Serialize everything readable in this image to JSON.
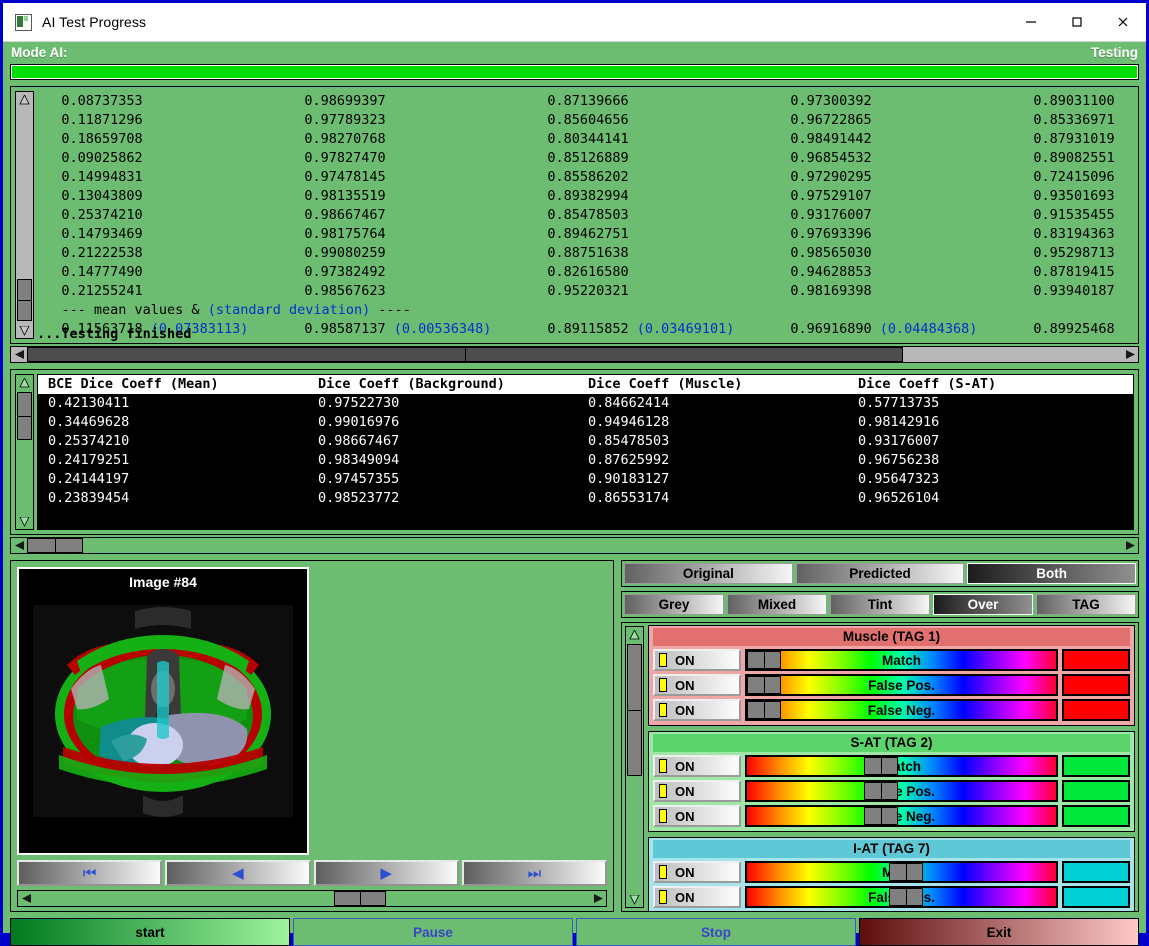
{
  "window": {
    "title": "AI Test Progress",
    "icon": "app-icon",
    "minimize": "—",
    "maximize": "□",
    "close": "✕"
  },
  "mode_bar": {
    "label": "Mode AI:",
    "status": "Testing"
  },
  "progress": {
    "percent": 100,
    "color": "#00e000"
  },
  "log": {
    "rows": [
      [
        "0.08737353",
        "0.98699397",
        "0.87139666",
        "0.97300392",
        "0.89031100"
      ],
      [
        "0.11871296",
        "0.97789323",
        "0.85604656",
        "0.96722865",
        "0.85336971"
      ],
      [
        "0.18659708",
        "0.98270768",
        "0.80344141",
        "0.98491442",
        "0.87931019"
      ],
      [
        "0.09025862",
        "0.97827470",
        "0.85126889",
        "0.96854532",
        "0.89082551"
      ],
      [
        "0.14994831",
        "0.97478145",
        "0.85586202",
        "0.97290295",
        "0.72415096"
      ],
      [
        "0.13043809",
        "0.98135519",
        "0.89382994",
        "0.97529107",
        "0.93501693"
      ],
      [
        "0.25374210",
        "0.98667467",
        "0.85478503",
        "0.93176007",
        "0.91535455"
      ],
      [
        "0.14793469",
        "0.98175764",
        "0.89462751",
        "0.97693396",
        "0.83194363"
      ],
      [
        "0.21222538",
        "0.99080259",
        "0.88751638",
        "0.98565030",
        "0.95298713"
      ],
      [
        "0.14777490",
        "0.97382492",
        "0.82616580",
        "0.94628853",
        "0.87819415"
      ],
      [
        "0.21255241",
        "0.98567623",
        "0.95220321",
        "0.98169398",
        "0.93940187"
      ]
    ],
    "separator_prefix": "--- mean values & ",
    "separator_blue": "(standard deviation)",
    "separator_suffix": " ----",
    "means": [
      {
        "mean": "0.11563718",
        "sd": "(0.07383113)"
      },
      {
        "mean": "0.98587137",
        "sd": "(0.00536348)"
      },
      {
        "mean": "0.89115852",
        "sd": "(0.03469101)"
      },
      {
        "mean": "0.96916890",
        "sd": "(0.04484368)"
      },
      {
        "mean": "0.89925468",
        "sd": ""
      }
    ],
    "footer": "...Testing finished"
  },
  "table": {
    "headers": [
      "BCE Dice Coeff (Mean)",
      "Dice Coeff (Background)",
      "Dice Coeff (Muscle)",
      "Dice Coeff (S-AT)"
    ],
    "rows": [
      [
        "0.42130411",
        "0.97522730",
        "0.84662414",
        "0.57713735"
      ],
      [
        "0.34469628",
        "0.99016976",
        "0.94946128",
        "0.98142916"
      ],
      [
        "0.25374210",
        "0.98667467",
        "0.85478503",
        "0.93176007"
      ],
      [
        "0.24179251",
        "0.98349094",
        "0.87625992",
        "0.96756238"
      ],
      [
        "0.24144197",
        "0.97457355",
        "0.90183127",
        "0.95647323"
      ],
      [
        "0.23839454",
        "0.98523772",
        "0.86553174",
        "0.96526104"
      ]
    ]
  },
  "viewer": {
    "image_title": "Image #84",
    "nav": [
      {
        "name": "first-image-button",
        "glyph": "⏮"
      },
      {
        "name": "previous-image-button",
        "glyph": "◀"
      },
      {
        "name": "next-image-button",
        "glyph": "▶"
      },
      {
        "name": "last-image-button",
        "glyph": "⏭"
      }
    ]
  },
  "view_tabs": {
    "row1": [
      {
        "label": "Original",
        "active": false
      },
      {
        "label": "Predicted",
        "active": false
      },
      {
        "label": "Both",
        "active": true
      }
    ],
    "row2": [
      {
        "label": "Grey",
        "active": false
      },
      {
        "label": "Mixed",
        "active": false
      },
      {
        "label": "Tint",
        "active": false
      },
      {
        "label": "Over",
        "active": true
      },
      {
        "label": "TAG",
        "active": false
      }
    ]
  },
  "tag_groups": [
    {
      "title": "Muscle (TAG 1)",
      "header_color": "#e2706e",
      "body_color": "#eea7a4",
      "swatch_color": "#ff0000",
      "rows": [
        {
          "toggle": "ON",
          "label": "Match",
          "thumb_pct": 0
        },
        {
          "toggle": "ON",
          "label": "False Pos.",
          "thumb_pct": 0
        },
        {
          "toggle": "ON",
          "label": "False Neg.",
          "thumb_pct": 0
        }
      ]
    },
    {
      "title": "S-AT (TAG 2)",
      "header_color": "#5bd46b",
      "body_color": "#9ee8a6",
      "swatch_color": "#00e83c",
      "rows": [
        {
          "toggle": "ON",
          "label": "Match",
          "thumb_pct": 38
        },
        {
          "toggle": "ON",
          "label": "False Pos.",
          "thumb_pct": 38
        },
        {
          "toggle": "ON",
          "label": "False Neg.",
          "thumb_pct": 38
        }
      ]
    },
    {
      "title": "I-AT (TAG 7)",
      "header_color": "#5ec8d6",
      "body_color": "#a6e4ec",
      "swatch_color": "#00cfd6",
      "rows": [
        {
          "toggle": "ON",
          "label": "Match",
          "thumb_pct": 46
        },
        {
          "toggle": "ON",
          "label": "False Pos.",
          "thumb_pct": 46
        }
      ]
    }
  ],
  "actions": [
    {
      "label": "start",
      "style": "start"
    },
    {
      "label": "Pause",
      "style": "plain"
    },
    {
      "label": "Stop",
      "style": "plain"
    },
    {
      "label": "Exit",
      "style": "exit"
    }
  ]
}
